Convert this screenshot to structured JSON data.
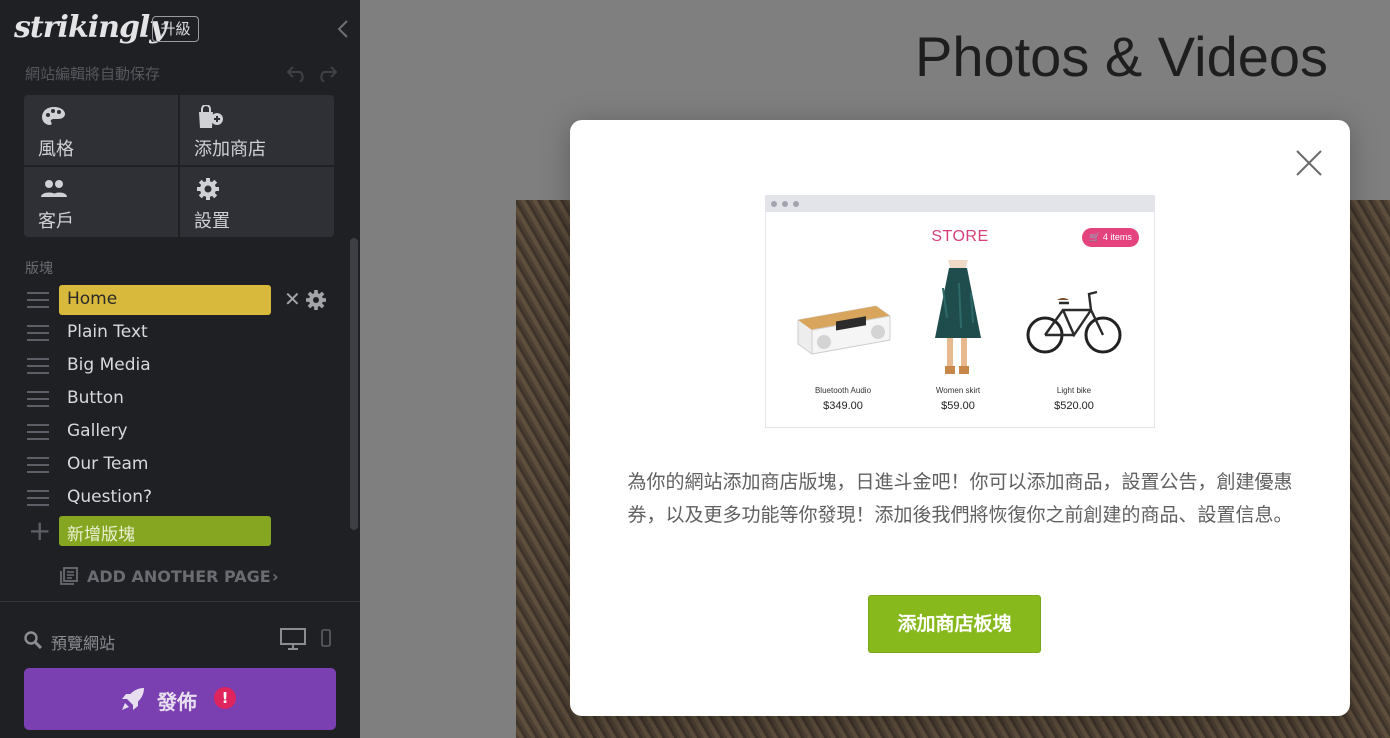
{
  "sidebar": {
    "logo": "strikingly",
    "upgrade_label": "升級",
    "autosave_text": "網站編輯將自動保存",
    "tiles": [
      {
        "label": "風格",
        "icon": "palette-icon"
      },
      {
        "label": "添加商店",
        "icon": "store-add-icon"
      },
      {
        "label": "客戶",
        "icon": "people-icon"
      },
      {
        "label": "設置",
        "icon": "gear-icon"
      }
    ],
    "blocks_title": "版塊",
    "blocks": [
      "Home",
      "Plain Text",
      "Big Media",
      "Button",
      "Gallery",
      "Our Team",
      "Question?"
    ],
    "active_block": "Home",
    "add_block_label": "新增版塊",
    "add_page_label": "ADD ANOTHER PAGE",
    "preview_label": "預覽網站",
    "publish_label": "發佈",
    "publish_alert": "!"
  },
  "main": {
    "heading": "Photos & Videos"
  },
  "modal": {
    "store_preview": {
      "title": "STORE",
      "cart_label": "4 items",
      "products": [
        {
          "name": "Bluetooth Audio",
          "price": "$349.00"
        },
        {
          "name": "Women skirt",
          "price": "$59.00"
        },
        {
          "name": "Light bike",
          "price": "$520.00"
        }
      ]
    },
    "message": "為你的網站添加商店版塊，日進斗金吧！你可以添加商品，設置公告，創建優惠券，以及更多功能等你發現！添加後我們將恢復你之前創建的商品、設置信息。",
    "button_label": "添加商店板塊"
  },
  "colors": {
    "sidebar_bg": "#1f2024",
    "active_block": "#d9b93b",
    "add_block": "#86a621",
    "publish": "#7a3fb0",
    "modal_button": "#87b91d",
    "store_accent": "#e4437e"
  }
}
